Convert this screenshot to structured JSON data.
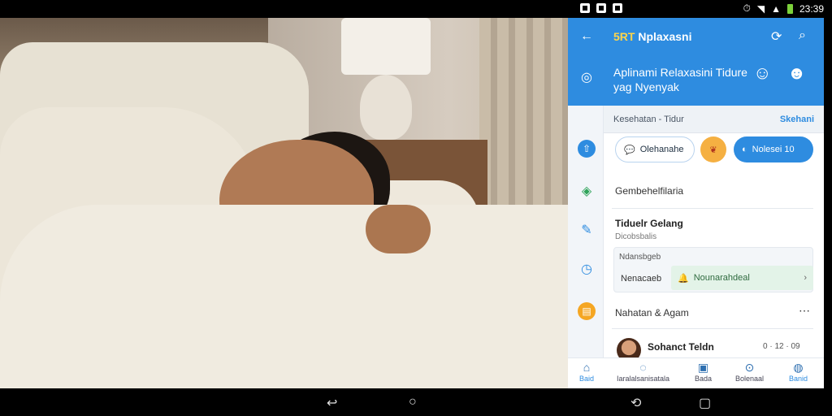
{
  "status_bar": {
    "time": "23:39"
  },
  "app": {
    "brand_prefix": "5RT",
    "title": "Nplaxasni",
    "subtitle": "Aplinami Relaxasini Tidure yag Nyenyak",
    "category_left": "Kesehatan - Tidur",
    "category_right": "Skehani",
    "chips": [
      "Olehanahe",
      "Nolesei 10"
    ],
    "section1": "Gembehelfilaria",
    "section2_title": "Tiduelr Gelang",
    "section2_sub": "Dicobsbalis",
    "card": {
      "label": "Ndansbgeb",
      "left": "Nenacaeb",
      "pill": "Nounarahdeal"
    },
    "section3": "Nahatan & Agam",
    "chat": {
      "name": "Sohanct Teldn",
      "meta": "0 · 12  · 09"
    },
    "nav": [
      "Baid",
      "Iaralalsanisatala",
      "Bada",
      "Bolenaal",
      "Banid"
    ]
  },
  "colors": {
    "primary": "#2e8ce0",
    "accent": "#ffd54a",
    "success": "#e3f3e8"
  }
}
